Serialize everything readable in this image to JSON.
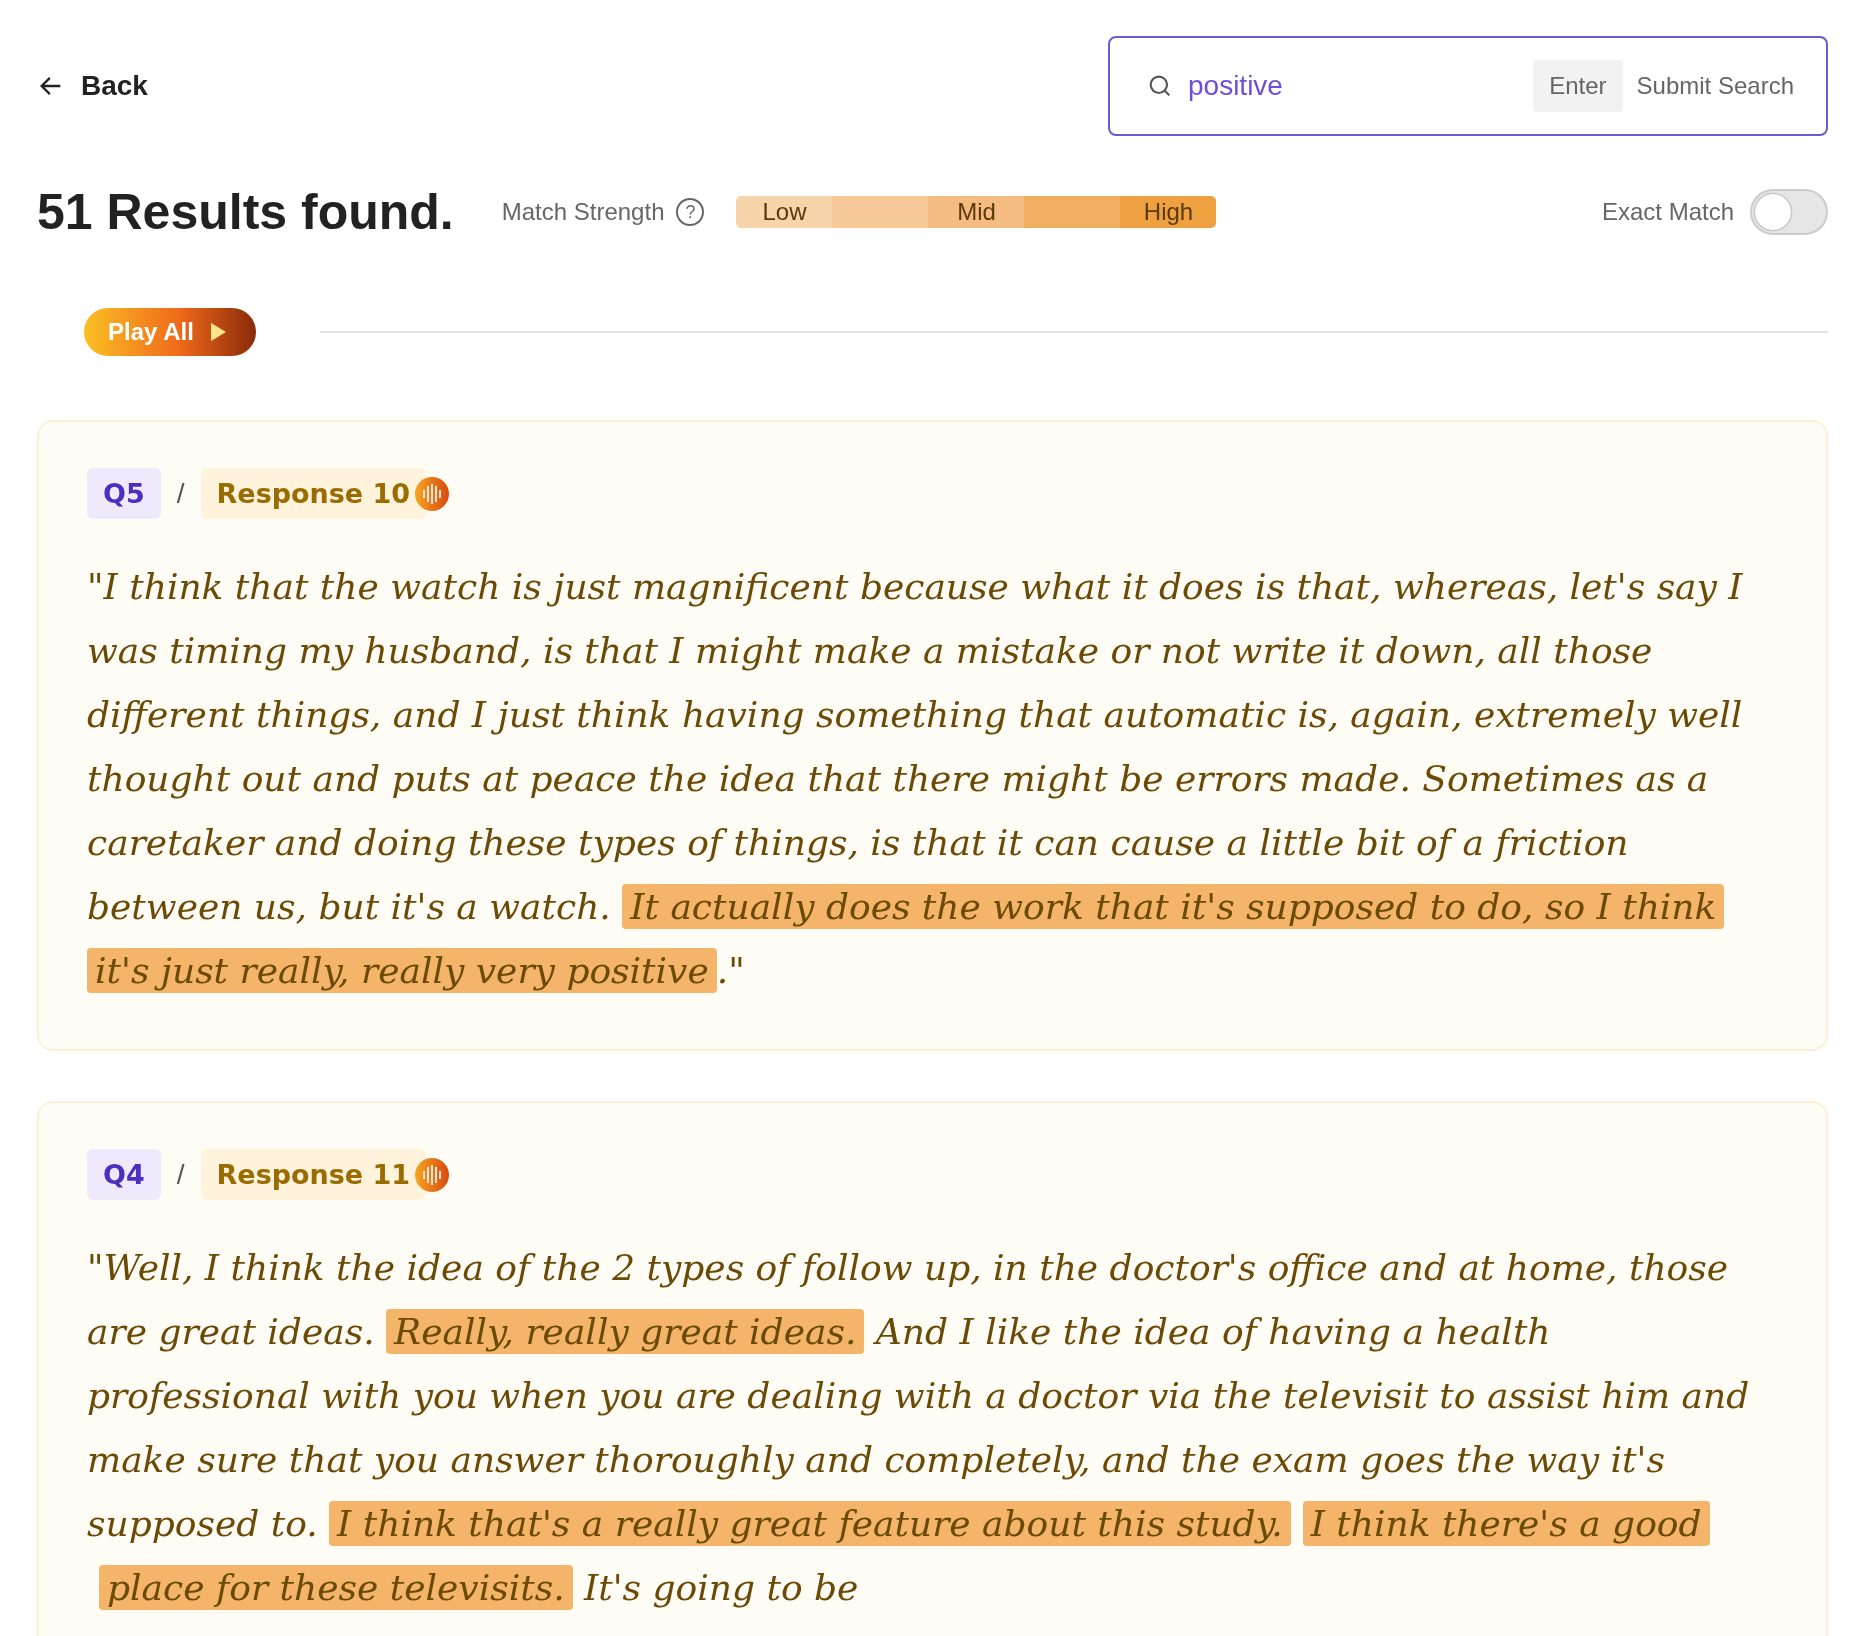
{
  "back": {
    "label": "Back"
  },
  "search": {
    "value": "positive",
    "key_hint": "Enter",
    "submit": "Submit Search"
  },
  "results_title": "51 Results found.",
  "match_strength": {
    "label": "Match Strength",
    "help": "?",
    "segments": [
      {
        "label": "Low",
        "color": "#f8d4aa"
      },
      {
        "color": "#f7c998"
      },
      {
        "label": "Mid",
        "color": "#f4bc80"
      },
      {
        "color": "#f2ae62"
      },
      {
        "label": "High",
        "color": "#efa03f"
      }
    ]
  },
  "exact_match": {
    "label": "Exact Match",
    "on": false
  },
  "play_all": "Play All",
  "results": [
    {
      "question": "Q5",
      "separator": "/",
      "response": "Response 10",
      "segments": [
        {
          "text": "\"I think that the watch is just magnificent because what it does is that, whereas, let's say I was timing my husband, is that I might make a mistake or not write it down, all those different things, and I just think having something that automatic is, again, extremely well thought out and puts at peace the idea that there might be errors made. Sometimes as a caretaker and doing these types of things, is that it can cause a little bit of a friction between us, but it's a watch. ",
          "highlight": false
        },
        {
          "text": "It actually does the work that it's supposed to do, so I think it's just really, really very positive",
          "highlight": true
        },
        {
          "text": ".\"",
          "highlight": false
        }
      ]
    },
    {
      "question": "Q4",
      "separator": "/",
      "response": "Response 11",
      "segments": [
        {
          "text": "\"Well, I think the idea of the 2 types of follow up, in the doctor's office and at home, those are great ideas. ",
          "highlight": false
        },
        {
          "text": "Really, really great ideas.",
          "highlight": true
        },
        {
          "text": " And I like the idea of having a health professional with you when you are dealing with a doctor via the televisit to assist him and make sure that you answer thoroughly and completely, and the exam goes the way it's supposed to. ",
          "highlight": false
        },
        {
          "text": "I think that's a really great feature about this study.",
          "highlight": true
        },
        {
          "text": "I think there's a good place for these televisits.",
          "highlight": true
        },
        {
          "text": " It's going to be",
          "highlight": false
        }
      ]
    }
  ]
}
